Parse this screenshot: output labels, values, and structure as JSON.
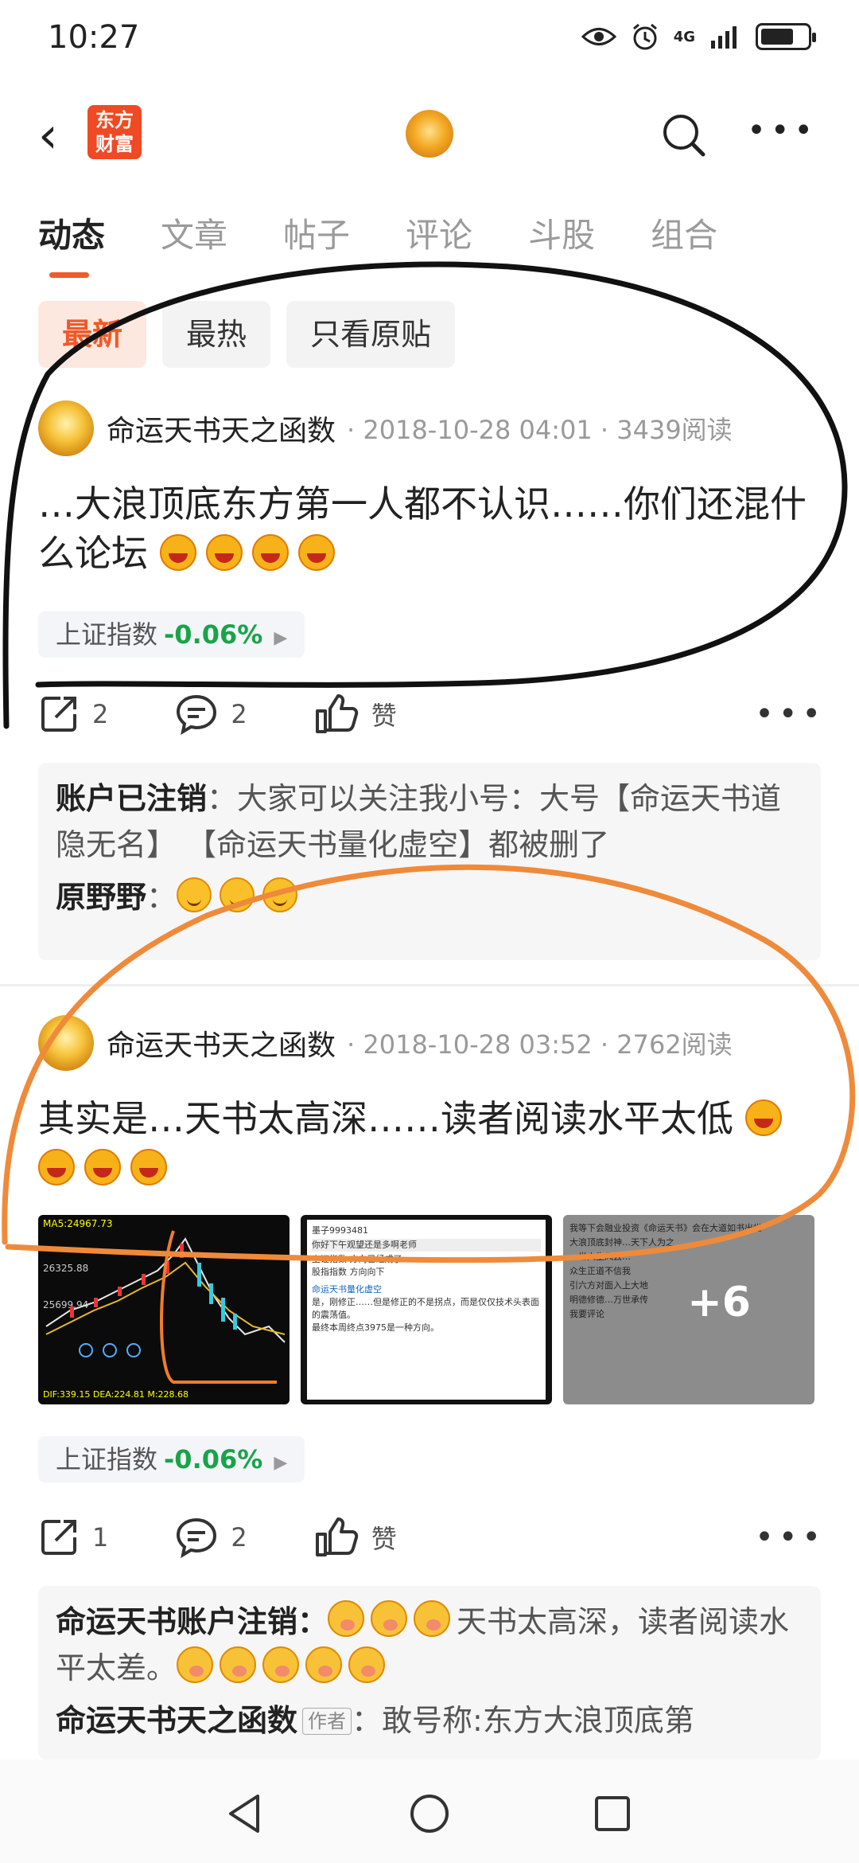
{
  "status_bar": {
    "time": "10:27",
    "network": "4G"
  },
  "nav": {
    "logo_text": "东方财富"
  },
  "tabs": [
    {
      "label": "动态",
      "active": true
    },
    {
      "label": "文章"
    },
    {
      "label": "帖子"
    },
    {
      "label": "评论"
    },
    {
      "label": "斗股"
    },
    {
      "label": "组合"
    }
  ],
  "filters": [
    {
      "label": "最新",
      "active": true
    },
    {
      "label": "最热"
    },
    {
      "label": "只看原贴"
    }
  ],
  "posts": [
    {
      "author": "命运天书天之函数",
      "meta": "· 2018-10-28 04:01 · 3439阅读",
      "text": "…大浪顶底东方第一人都不认识……你们还混什么论坛",
      "index_label": "上证指数",
      "index_pct": "-0.06%",
      "shares": "2",
      "comments": "2",
      "like_label": "赞",
      "replies": [
        {
          "name": "账户已注销",
          "text": "：大家可以关注我小号：大号【命运天书道隐无名】 【命运天书量化虚空】都被删了"
        },
        {
          "name": "原野野",
          "text": "："
        }
      ]
    },
    {
      "author": "命运天书天之函数",
      "meta": "· 2018-10-28 03:52 · 2762阅读",
      "text": "其实是…天书太高深……读者阅读水平太低",
      "more_images": "+6",
      "index_label": "上证指数",
      "index_pct": "-0.06%",
      "shares": "1",
      "comments": "2",
      "like_label": "赞",
      "replies": [
        {
          "name": "命运天书账户注销",
          "text": "天书太高深，读者阅读水平太差。"
        },
        {
          "name": "命运天书天之函数",
          "tag": "作者",
          "text": "：敢号称:东方大浪顶底第"
        }
      ]
    }
  ],
  "thumb1": {
    "ma": "MA5:24967.73",
    "val1": "26325.88",
    "val2": "25699.94",
    "macd": "DIF:339.15 DEA:224.81 M:228.68"
  },
  "thumb2": {
    "l1": "墨子9993481",
    "l2": "你好下午观望还是多啊老师",
    "l3": "上证指数 方向已经成了……",
    "l4": "股指指数 方向向下",
    "l5": "命运天书量化虚空",
    "l6": "是，刚修正……但是修正的不是拐点，而是仅仅技术头表面的震荡值。",
    "l7": "最终本周终点3975是一种方向。"
  },
  "thumb3": {
    "l1": "我等下会融业投资《命运天书》会在大道如书出世",
    "l2": "大浪顶底封神…天下人为之",
    "l3": "一世人生风云…",
    "l4": "众生正道不信我",
    "l5": "引六方对面入上大地",
    "l6": "明德修德…万世承传",
    "l7": "我要评论"
  },
  "colors": {
    "accent": "#ef5a2a",
    "up": "#1aa34a"
  }
}
